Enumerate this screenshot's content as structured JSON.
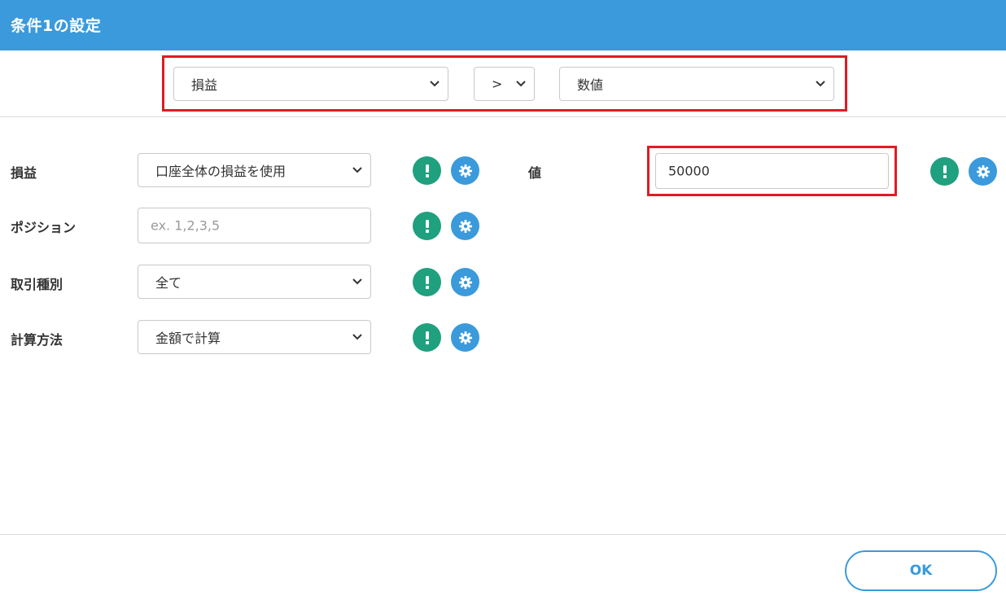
{
  "dialog": {
    "title": "条件1の設定"
  },
  "condition": {
    "left_select": "損益",
    "operator_select": ">",
    "right_select": "数値"
  },
  "fields": {
    "profit": {
      "label": "損益",
      "value": "口座全体の損益を使用"
    },
    "position": {
      "label": "ポジション",
      "placeholder": "ex. 1,2,3,5"
    },
    "trade_type": {
      "label": "取引種別",
      "value": "全て"
    },
    "calc_method": {
      "label": "計算方法",
      "value": "金額で計算"
    },
    "value": {
      "label": "値",
      "value": "50000"
    }
  },
  "icons": {
    "info": "exclamation-icon",
    "settings": "gear-icon"
  },
  "colors": {
    "header": "#3a9adb",
    "info_icon": "#1fa07e",
    "settings_icon": "#3a9adb",
    "highlight": "#e01b24",
    "ok_button": "#3a9adb"
  },
  "footer": {
    "ok_label": "OK"
  }
}
